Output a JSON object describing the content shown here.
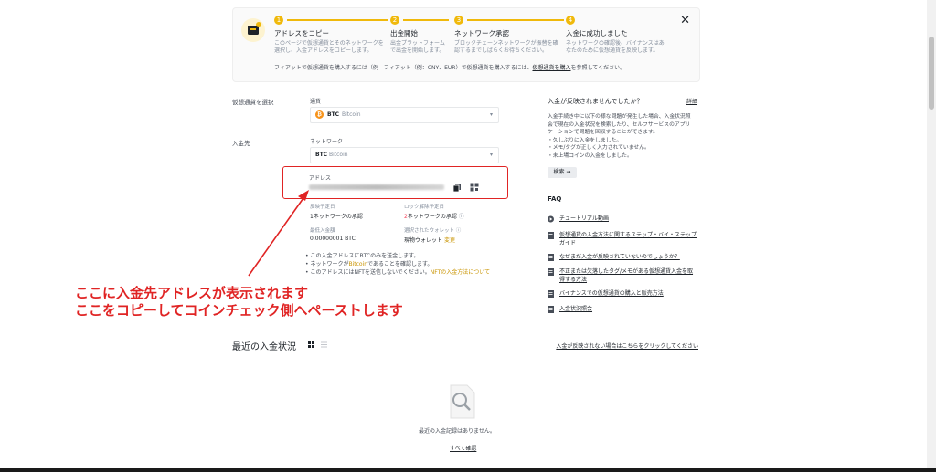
{
  "steps": {
    "close": "✕",
    "items": [
      {
        "num": "1",
        "title": "アドレスをコピー",
        "desc": [
          "このページで仮想通貨とそのネットワークを",
          "選択し、入金アドレスをコピーします。"
        ]
      },
      {
        "num": "2",
        "title": "出金開始",
        "desc": [
          "出金プラットフォーム",
          "で出金を開始します。"
        ]
      },
      {
        "num": "3",
        "title": "ネットワーク承認",
        "desc": [
          "ブロックチェーンネットワークが振替を確",
          "認するまでしばらくお待ちください。"
        ]
      },
      {
        "num": "4",
        "title": "入金に成功しました",
        "desc": [
          "ネットワークの確認後、バイナンスはあ",
          "なたのために仮想通貨を反映します。"
        ]
      }
    ],
    "fiat_note_pre": "フィアットで仮想通貨を購入するには（例　フィアット（例：CNY、EUR）で仮想通貨を購入するには、",
    "fiat_note_link": "仮想通貨を購入",
    "fiat_note_post": "を参照してください。"
  },
  "form": {
    "coin_section_label": "仮想通貨を選択",
    "coin_field_label": "通貨",
    "coin_symbol": "BTC",
    "coin_name": "Bitcoin",
    "coin_badge": "₿",
    "deposit_label": "入金先",
    "network_label": "ネットワーク",
    "network_symbol": "BTC",
    "network_name": "Bitcoin",
    "address_label": "アドレス"
  },
  "info": {
    "expected_arrival_label": "反映予定日",
    "expected_arrival_num": "1",
    "expected_arrival_text": "ネットワークの承認",
    "unlock_label": "ロック解除予定日",
    "unlock_num": "2",
    "unlock_text": "ネットワークの承認",
    "min_deposit_label": "最低入金額",
    "min_deposit_value": "0.00000001 BTC",
    "wallet_label": "選択されたウォレット",
    "wallet_value": "現物ウォレット",
    "wallet_change": "変更"
  },
  "notes": {
    "n1": "この入金アドレスにBTCのみを送金します。",
    "n2_pre": "ネットワークが",
    "n2_hl": "Bitcoin",
    "n2_post": "であることを確認します。",
    "n3_pre": "このアドレスにはNFTを送信しないでください。",
    "n3_link": "NFTの入金方法について"
  },
  "annotation": {
    "line1": "ここに入金先アドレスが表示されます",
    "line2": "ここをコピーしてコインチェック側へペーストします"
  },
  "history": {
    "title": "最近の入金状況",
    "link": "入金が反映されない場合はこちらをクリックしてください",
    "empty": "最近の入金記録はありません。",
    "view_all": "すべて確認"
  },
  "side": {
    "title": "入金が反映されませんでしたか？",
    "detail": "詳細",
    "desc": [
      "入金手続き中に以下の様な問題が発生した場合、入金状況照",
      "会で現在の入金状況を検索したり、セルフサービスのアプリ",
      "ケーションで問題を回収することができます。",
      "・久しぶりに入金をしました。",
      "・メモ/タグが正しく入力されていません。",
      "・未上場コインの入金をしました。"
    ],
    "search": "検索 ➔",
    "faq_title": "FAQ",
    "faq": [
      {
        "icon": "play-icon",
        "lines": [
          "チュートリアル動画"
        ]
      },
      {
        "icon": "doc-icon",
        "lines": [
          "仮想通貨の入金方法に関するステップ・バイ・ステップ",
          "ガイド"
        ]
      },
      {
        "icon": "doc-icon",
        "lines": [
          "なぜまだ入金が反映されていないのでしょうか？"
        ]
      },
      {
        "icon": "doc-icon",
        "lines": [
          "不正または欠落したタグ/メモがある仮想通貨入金を取",
          "得する方法"
        ]
      },
      {
        "icon": "doc-icon",
        "lines": [
          "バイナンスでの仮想通貨の購入と販売方法"
        ]
      },
      {
        "icon": "doc-icon",
        "lines": [
          "入金状況照会"
        ]
      }
    ]
  },
  "colors": {
    "accent": "#f0b90b",
    "annotation": "#e02424",
    "error": "#f6465d",
    "btc": "#f7931a"
  }
}
